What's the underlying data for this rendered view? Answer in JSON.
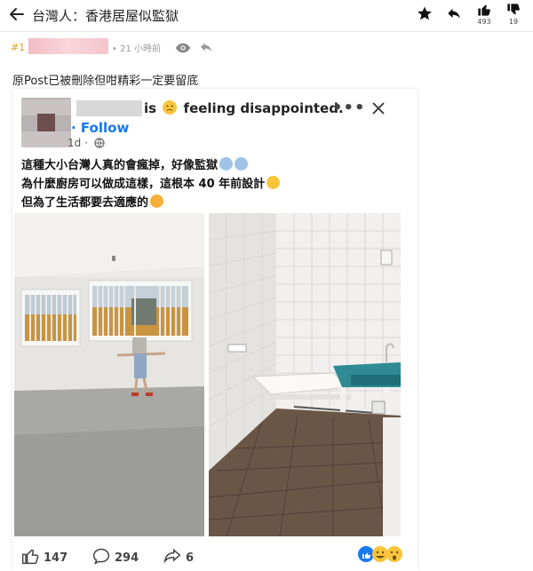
{
  "topbar": {
    "title": "台灣人：香港居屋似監獄",
    "upvotes": "493",
    "downvotes": "19",
    "icons": [
      "back-arrow-icon",
      "star-icon",
      "reply-icon",
      "thumbs-up-icon",
      "thumbs-down-icon"
    ]
  },
  "post": {
    "floor": "#1",
    "time": "• 21 小時前",
    "caption": "原Post已被刪除但咁精彩一定要留底"
  },
  "fb": {
    "status_is": "is",
    "status_feeling": "feeling disappointed.",
    "more": "•••",
    "follow": "· Follow",
    "time": "1d ·",
    "lines": [
      "這種大小台灣人真的會瘋掉，好像監獄",
      "為什麼廚房可以做成這樣，這根本 40 年前設計",
      "但為了生活都要去適應的"
    ],
    "likes": "147",
    "comments": "294",
    "shares": "6"
  },
  "colors": {
    "accent": "#1877f2",
    "floor": "#e0a020",
    "emoji": "#f8c53a"
  }
}
